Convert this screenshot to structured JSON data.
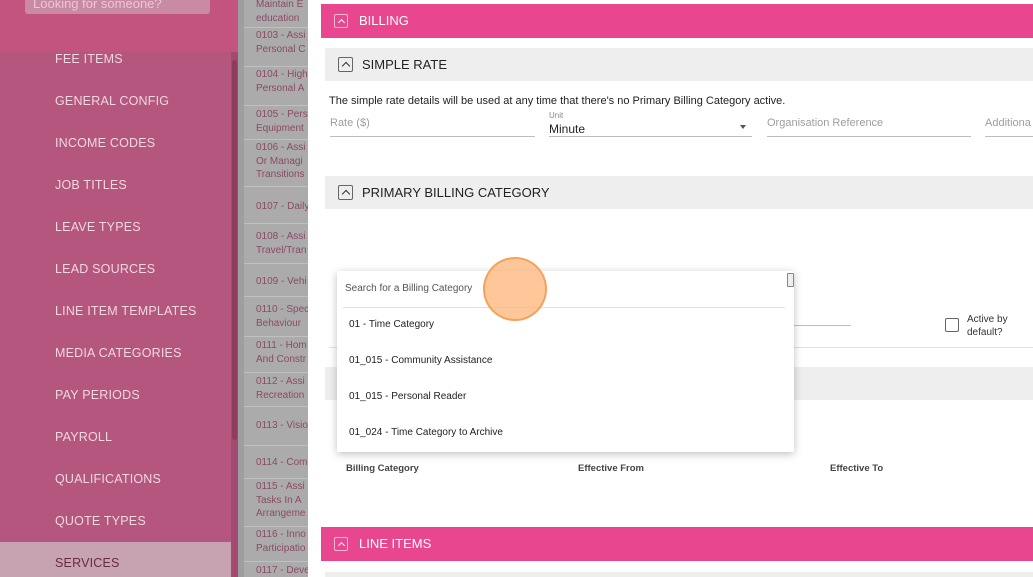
{
  "sidebar": {
    "search_placeholder": "Looking for someone?",
    "items": [
      {
        "label": "FEE ITEMS"
      },
      {
        "label": "GENERAL CONFIG"
      },
      {
        "label": "INCOME CODES"
      },
      {
        "label": "JOB TITLES"
      },
      {
        "label": "LEAVE TYPES"
      },
      {
        "label": "LEAD SOURCES"
      },
      {
        "label": "LINE ITEM TEMPLATES"
      },
      {
        "label": "MEDIA CATEGORIES"
      },
      {
        "label": "PAY PERIODS"
      },
      {
        "label": "PAYROLL"
      },
      {
        "label": "QUALIFICATIONS"
      },
      {
        "label": "QUOTE TYPES"
      },
      {
        "label": "SERVICES"
      }
    ]
  },
  "services_list": [
    {
      "line1": "Maintain E",
      "line2": "education"
    },
    {
      "line1": "0103 - Assi",
      "line2": "Personal C"
    },
    {
      "line1": "0104 - High",
      "line2": "Personal A"
    },
    {
      "line1": "0105 - Pers",
      "line2": "Equipment"
    },
    {
      "line1": "0106 - Assi",
      "line2": "Or Managi",
      "line3": "Transitions"
    },
    {
      "line1": "0107 - Daily"
    },
    {
      "line1": "0108 - Assi",
      "line2": "Travel/Tran"
    },
    {
      "line1": "0109 - Vehi"
    },
    {
      "line1": "0110 - Spec",
      "line2": "Behaviour"
    },
    {
      "line1": "0111 - Hom",
      "line2": "And Constr"
    },
    {
      "line1": "0112 - Assi",
      "line2": "Recreation"
    },
    {
      "line1": "0113 - Visio"
    },
    {
      "line1": "0114 - Com"
    },
    {
      "line1": "0115 - Assi",
      "line2": "Tasks In A",
      "line3": "Arrangeme"
    },
    {
      "line1": "0116 - Inno",
      "line2": "Participatio"
    },
    {
      "line1": "0117 - Deve"
    }
  ],
  "billing": {
    "title": "BILLING",
    "simple_rate": {
      "title": "SIMPLE RATE",
      "description": "The simple rate details will be used at any time that there's no Primary Billing Category active.",
      "rate_placeholder": "Rate ($)",
      "unit_label": "Unit",
      "unit_value": "Minute",
      "org_ref_placeholder": "Organisation Reference",
      "additional_placeholder": "Additiona"
    },
    "primary_category": {
      "title": "PRIMARY BILLING CATEGORY",
      "active_by_default_label": "Active by default?"
    },
    "table_headers": {
      "billing_category": "Billing Category",
      "effective_from": "Effective From",
      "effective_to": "Effective To"
    }
  },
  "line_items": {
    "title": "LINE ITEMS"
  },
  "dropdown": {
    "search_placeholder": "Search for a Billing Category",
    "options": [
      "01 - Time Category",
      "01_015 - Community Assistance",
      "01_015 - Personal Reader",
      "01_024 - Time Category to Archive"
    ]
  },
  "colors": {
    "accent_pink": "#e8468e",
    "sidebar_dim": "#b5567f",
    "section_grey": "#eeeeee"
  },
  "icons": {
    "section_toggle": "chevron-up-icon",
    "dropdown_caret": "caret-down-icon",
    "checkbox": "checkbox-icon"
  }
}
